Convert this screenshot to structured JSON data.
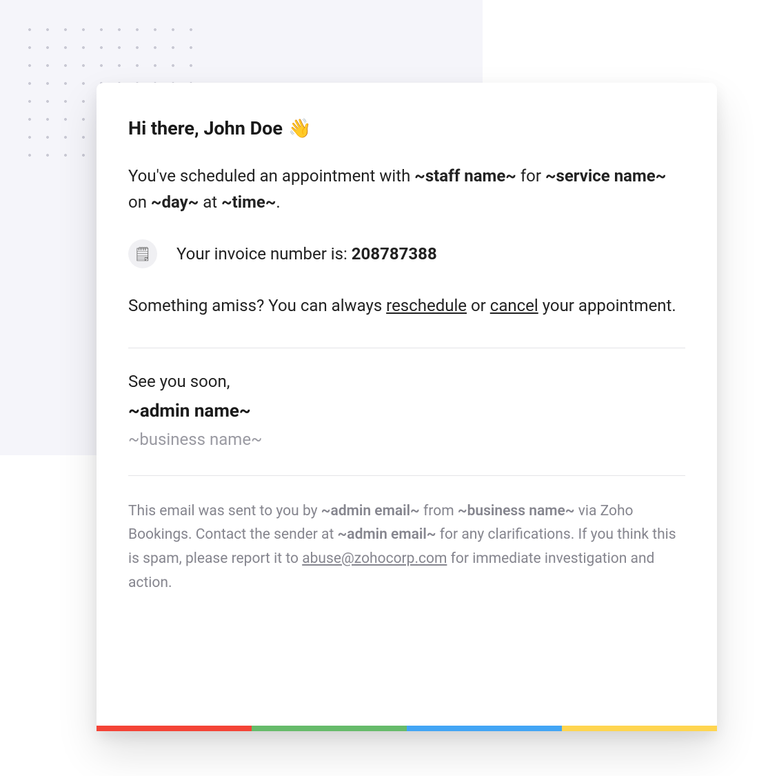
{
  "greeting": {
    "prefix": "Hi there, ",
    "name": "John Doe",
    "wave": "👋"
  },
  "body": {
    "t1": "You've scheduled an appointment with ",
    "staff": "~staff name~",
    "t2": " for ",
    "service": "~service name~",
    "t3": " on ",
    "day": "~day~",
    "t4": " at ",
    "time": "~time~",
    "t5": "."
  },
  "invoice": {
    "icon_glyph": "🗒",
    "label": "Your invoice number is: ",
    "number": "208787388"
  },
  "actions": {
    "t1": "Something amiss? You can always ",
    "reschedule": "reschedule",
    "t2": " or ",
    "cancel": "cancel",
    "t3": " your appointment."
  },
  "signoff": {
    "see_you": "See you soon,",
    "admin_name": "~admin name~",
    "business_name": "~business name~"
  },
  "footer": {
    "t1": "This email was sent to you by ",
    "admin_email_1": "~admin email~",
    "t2": " from ",
    "business_name": "~business name~",
    "t3": " via Zoho Bookings. Contact the sender at ",
    "admin_email_2": "~admin email~",
    "t4": " for any clarifications. If you think this is spam, please report it to ",
    "abuse": "abuse@zohocorp.com",
    "t5": " for immediate investigation and action."
  },
  "strip_colors": {
    "red": "#f44336",
    "green": "#66bb6a",
    "blue": "#42a5f5",
    "yellow": "#ffd54f"
  }
}
